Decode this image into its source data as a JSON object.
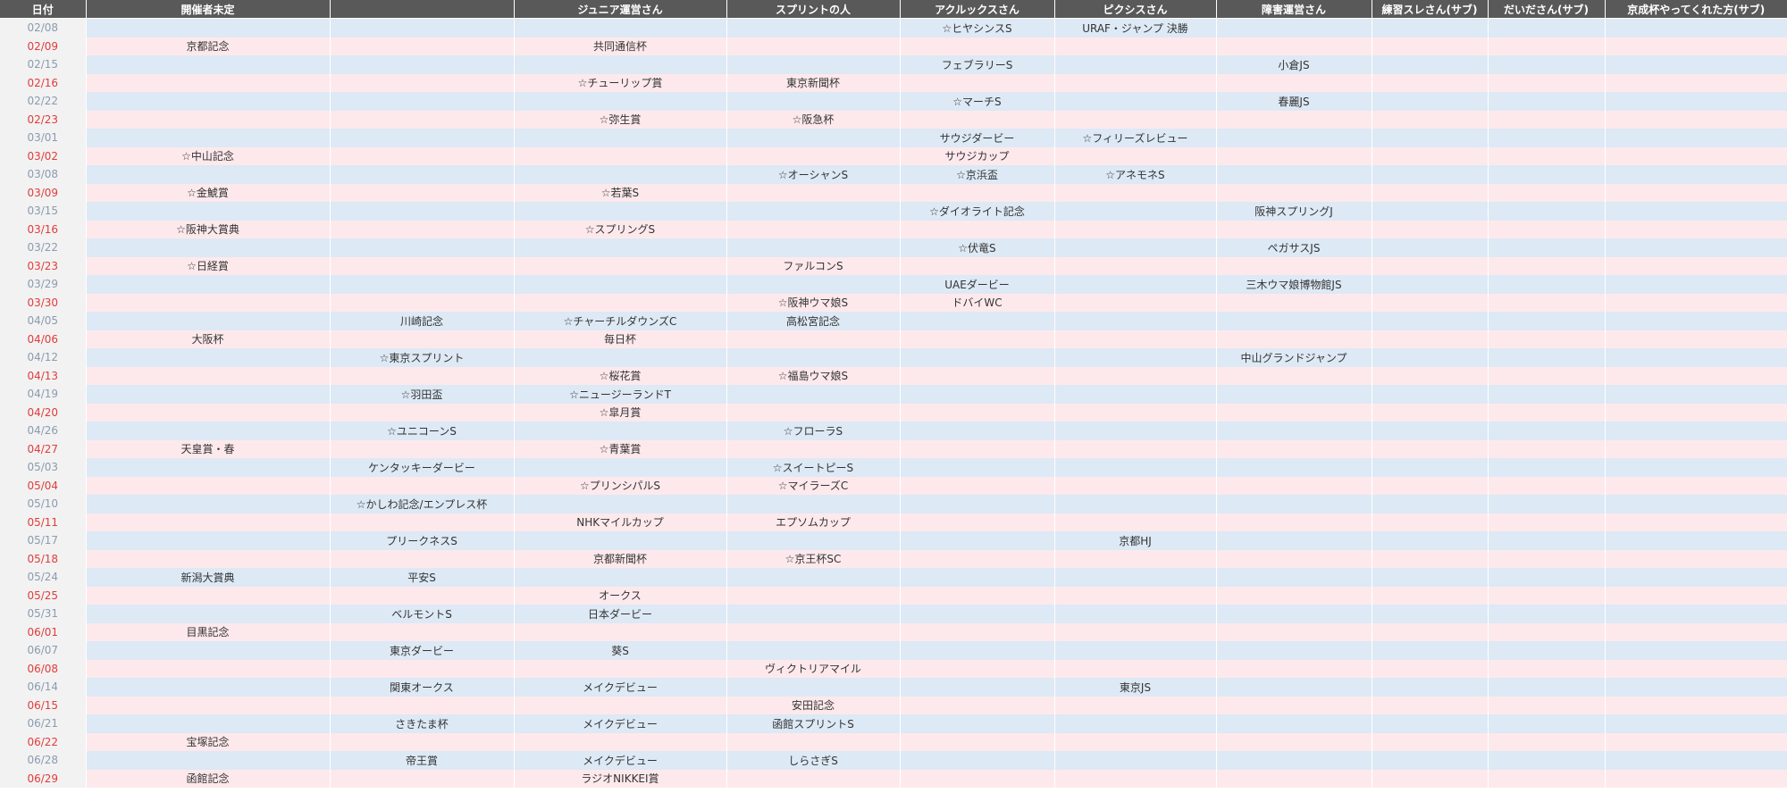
{
  "colors": {
    "header_bg": "#595959",
    "saturday_row": "#dde9f5",
    "sunday_row": "#fde9ec",
    "sunday_date": "#e23b3b",
    "saturday_date": "#8a9bb0"
  },
  "headers": [
    "日付",
    "開催者未定",
    "",
    "ジュニア運営さん",
    "スプリントの人",
    "アクルックスさん",
    "ピクシスさん",
    "障害運営さん",
    "練習スレさん(サブ)",
    "だいださん(サブ)",
    "京成杯やってくれた方(サブ)"
  ],
  "rows": [
    {
      "date": "02/08",
      "day": "sat",
      "cells": [
        "",
        "",
        "",
        "",
        "☆ヒヤシンスS",
        "URAF・ジャンプ 決勝",
        "",
        "",
        "",
        ""
      ]
    },
    {
      "date": "02/09",
      "day": "sun",
      "cells": [
        "京都記念",
        "",
        "共同通信杯",
        "",
        "",
        "",
        "",
        "",
        "",
        ""
      ]
    },
    {
      "date": "02/15",
      "day": "sat",
      "cells": [
        "",
        "",
        "",
        "",
        "フェブラリーS",
        "",
        "小倉JS",
        "",
        "",
        ""
      ]
    },
    {
      "date": "02/16",
      "day": "sun",
      "cells": [
        "",
        "",
        "☆チューリップ賞",
        "東京新聞杯",
        "",
        "",
        "",
        "",
        "",
        ""
      ]
    },
    {
      "date": "02/22",
      "day": "sat",
      "cells": [
        "",
        "",
        "",
        "",
        "☆マーチS",
        "",
        "春麗JS",
        "",
        "",
        ""
      ]
    },
    {
      "date": "02/23",
      "day": "sun",
      "cells": [
        "",
        "",
        "☆弥生賞",
        "☆阪急杯",
        "",
        "",
        "",
        "",
        "",
        ""
      ]
    },
    {
      "date": "03/01",
      "day": "sat",
      "cells": [
        "",
        "",
        "",
        "",
        "サウジダービー",
        "☆フィリーズレビュー",
        "",
        "",
        "",
        ""
      ]
    },
    {
      "date": "03/02",
      "day": "sun",
      "cells": [
        "☆中山記念",
        "",
        "",
        "",
        "サウジカップ",
        "",
        "",
        "",
        "",
        ""
      ]
    },
    {
      "date": "03/08",
      "day": "sat",
      "cells": [
        "",
        "",
        "",
        "☆オーシャンS",
        "☆京浜盃",
        "☆アネモネS",
        "",
        "",
        "",
        ""
      ]
    },
    {
      "date": "03/09",
      "day": "sun",
      "cells": [
        "☆金鯱賞",
        "",
        "☆若葉S",
        "",
        "",
        "",
        "",
        "",
        "",
        ""
      ]
    },
    {
      "date": "03/15",
      "day": "sat",
      "cells": [
        "",
        "",
        "",
        "",
        "☆ダイオライト記念",
        "",
        "阪神スプリングJ",
        "",
        "",
        ""
      ]
    },
    {
      "date": "03/16",
      "day": "sun",
      "cells": [
        "☆阪神大賞典",
        "",
        "☆スプリングS",
        "",
        "",
        "",
        "",
        "",
        "",
        ""
      ]
    },
    {
      "date": "03/22",
      "day": "sat",
      "cells": [
        "",
        "",
        "",
        "",
        "☆伏竜S",
        "",
        "ペガサスJS",
        "",
        "",
        ""
      ]
    },
    {
      "date": "03/23",
      "day": "sun",
      "cells": [
        "☆日経賞",
        "",
        "",
        "ファルコンS",
        "",
        "",
        "",
        "",
        "",
        ""
      ]
    },
    {
      "date": "03/29",
      "day": "sat",
      "cells": [
        "",
        "",
        "",
        "",
        "UAEダービー",
        "",
        "三木ウマ娘博物館JS",
        "",
        "",
        ""
      ]
    },
    {
      "date": "03/30",
      "day": "sun",
      "cells": [
        "",
        "",
        "",
        "☆阪神ウマ娘S",
        "ドバイWC",
        "",
        "",
        "",
        "",
        ""
      ]
    },
    {
      "date": "04/05",
      "day": "sat",
      "cells": [
        "",
        "川崎記念",
        "☆チャーチルダウンズC",
        "高松宮記念",
        "",
        "",
        "",
        "",
        "",
        ""
      ]
    },
    {
      "date": "04/06",
      "day": "sun",
      "cells": [
        "大阪杯",
        "",
        "毎日杯",
        "",
        "",
        "",
        "",
        "",
        "",
        ""
      ]
    },
    {
      "date": "04/12",
      "day": "sat",
      "cells": [
        "",
        "☆東京スプリント",
        "",
        "",
        "",
        "",
        "中山グランドジャンプ",
        "",
        "",
        ""
      ]
    },
    {
      "date": "04/13",
      "day": "sun",
      "cells": [
        "",
        "",
        "☆桜花賞",
        "☆福島ウマ娘S",
        "",
        "",
        "",
        "",
        "",
        ""
      ]
    },
    {
      "date": "04/19",
      "day": "sat",
      "cells": [
        "",
        "☆羽田盃",
        "☆ニュージーランドT",
        "",
        "",
        "",
        "",
        "",
        "",
        ""
      ]
    },
    {
      "date": "04/20",
      "day": "sun",
      "cells": [
        "",
        "",
        "☆皐月賞",
        "",
        "",
        "",
        "",
        "",
        "",
        ""
      ]
    },
    {
      "date": "04/26",
      "day": "sat",
      "cells": [
        "",
        "☆ユニコーンS",
        "",
        "☆フローラS",
        "",
        "",
        "",
        "",
        "",
        ""
      ]
    },
    {
      "date": "04/27",
      "day": "sun",
      "cells": [
        "天皇賞・春",
        "",
        "☆青葉賞",
        "",
        "",
        "",
        "",
        "",
        "",
        ""
      ]
    },
    {
      "date": "05/03",
      "day": "sat",
      "cells": [
        "",
        "ケンタッキーダービー",
        "",
        "☆スイートピーS",
        "",
        "",
        "",
        "",
        "",
        ""
      ]
    },
    {
      "date": "05/04",
      "day": "sun",
      "cells": [
        "",
        "",
        "☆プリンシパルS",
        "☆マイラーズC",
        "",
        "",
        "",
        "",
        "",
        ""
      ]
    },
    {
      "date": "05/10",
      "day": "sat",
      "cells": [
        "",
        "☆かしわ記念/エンプレス杯",
        "",
        "",
        "",
        "",
        "",
        "",
        "",
        ""
      ]
    },
    {
      "date": "05/11",
      "day": "sun",
      "cells": [
        "",
        "",
        "NHKマイルカップ",
        "エプソムカップ",
        "",
        "",
        "",
        "",
        "",
        ""
      ]
    },
    {
      "date": "05/17",
      "day": "sat",
      "cells": [
        "",
        "プリークネスS",
        "",
        "",
        "",
        "京都HJ",
        "",
        "",
        "",
        ""
      ]
    },
    {
      "date": "05/18",
      "day": "sun",
      "cells": [
        "",
        "",
        "京都新聞杯",
        "☆京王杯SC",
        "",
        "",
        "",
        "",
        "",
        ""
      ]
    },
    {
      "date": "05/24",
      "day": "sat",
      "cells": [
        "新潟大賞典",
        "平安S",
        "",
        "",
        "",
        "",
        "",
        "",
        "",
        ""
      ]
    },
    {
      "date": "05/25",
      "day": "sun",
      "cells": [
        "",
        "",
        "オークス",
        "",
        "",
        "",
        "",
        "",
        "",
        ""
      ]
    },
    {
      "date": "05/31",
      "day": "sat",
      "cells": [
        "",
        "ベルモントS",
        "日本ダービー",
        "",
        "",
        "",
        "",
        "",
        "",
        ""
      ]
    },
    {
      "date": "06/01",
      "day": "sun",
      "cells": [
        "目黒記念",
        "",
        "",
        "",
        "",
        "",
        "",
        "",
        "",
        ""
      ]
    },
    {
      "date": "06/07",
      "day": "sat",
      "cells": [
        "",
        "東京ダービー",
        "葵S",
        "",
        "",
        "",
        "",
        "",
        "",
        ""
      ]
    },
    {
      "date": "06/08",
      "day": "sun",
      "cells": [
        "",
        "",
        "",
        "ヴィクトリアマイル",
        "",
        "",
        "",
        "",
        "",
        ""
      ]
    },
    {
      "date": "06/14",
      "day": "sat",
      "cells": [
        "",
        "関東オークス",
        "メイクデビュー",
        "",
        "",
        "東京JS",
        "",
        "",
        "",
        ""
      ]
    },
    {
      "date": "06/15",
      "day": "sun",
      "cells": [
        "",
        "",
        "",
        "安田記念",
        "",
        "",
        "",
        "",
        "",
        ""
      ]
    },
    {
      "date": "06/21",
      "day": "sat",
      "cells": [
        "",
        "さきたま杯",
        "メイクデビュー",
        "函館スプリントS",
        "",
        "",
        "",
        "",
        "",
        ""
      ]
    },
    {
      "date": "06/22",
      "day": "sun",
      "cells": [
        "宝塚記念",
        "",
        "",
        "",
        "",
        "",
        "",
        "",
        "",
        ""
      ]
    },
    {
      "date": "06/28",
      "day": "sat",
      "cells": [
        "",
        "帝王賞",
        "メイクデビュー",
        "しらさぎS",
        "",
        "",
        "",
        "",
        "",
        ""
      ]
    },
    {
      "date": "06/29",
      "day": "sun",
      "cells": [
        "函館記念",
        "",
        "ラジオNIKKEI賞",
        "",
        "",
        "",
        "",
        "",
        "",
        ""
      ]
    }
  ]
}
